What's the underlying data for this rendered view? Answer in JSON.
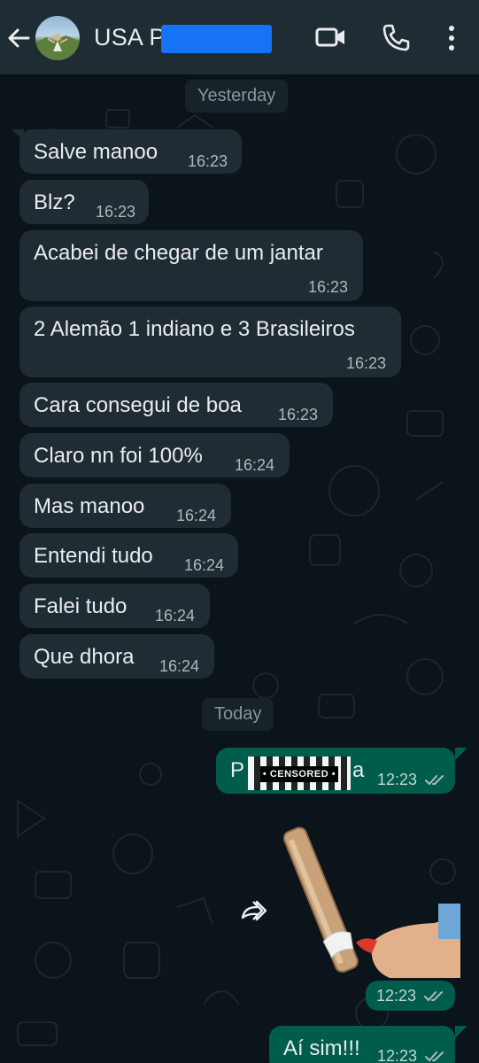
{
  "header": {
    "contact_name": "USA P",
    "icons": [
      "back-arrow-icon",
      "video-call-icon",
      "phone-icon",
      "more-vert-icon"
    ]
  },
  "chips": {
    "yesterday": "Yesterday",
    "today": "Today"
  },
  "messages_yesterday": [
    {
      "text": "Salve manoo",
      "time": "16:23"
    },
    {
      "text": "Blz?",
      "time": "16:23"
    },
    {
      "text": "Acabei de chegar de um jantar",
      "time": "16:23"
    },
    {
      "text": "2 Alemão 1 indiano e 3 Brasileiros",
      "time": "16:23"
    },
    {
      "text": "Cara consegui de boa",
      "time": "16:23"
    },
    {
      "text": "Claro nn foi 100%",
      "time": "16:24"
    },
    {
      "text": "Mas manoo",
      "time": "16:24"
    },
    {
      "text": "Entendi tudo",
      "time": "16:24"
    },
    {
      "text": "Falei tudo",
      "time": "16:24"
    },
    {
      "text": "Que dhora",
      "time": "16:24"
    }
  ],
  "messages_today": {
    "censored": {
      "prefix": "P",
      "suffix": "a",
      "censor_label": "• CENSORED •",
      "time": "12:23"
    },
    "sticker": {
      "time": "12:23"
    },
    "last": {
      "text": "Aí sim!!!",
      "time": "12:23"
    }
  },
  "colors": {
    "background": "#0b141a",
    "header": "#1f2c34",
    "incoming_bubble": "#202c33",
    "outgoing_bubble": "#005c4b",
    "redaction": "#1673f6"
  }
}
